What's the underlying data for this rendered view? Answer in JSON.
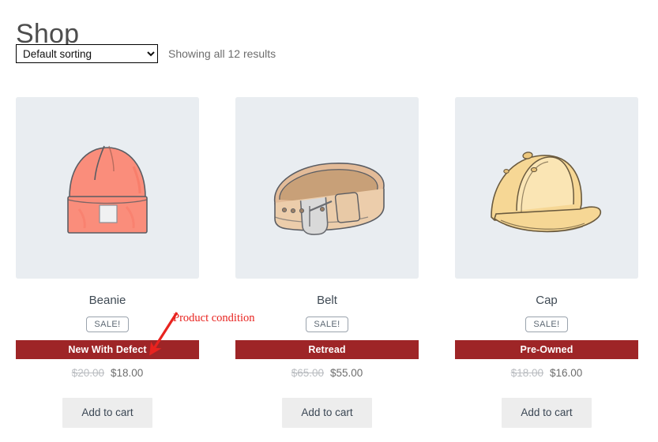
{
  "header": {
    "title": "Shop"
  },
  "toolbar": {
    "sort_selected": "Default sorting",
    "sort_options": [
      "Default sorting"
    ],
    "result_count": "Showing all 12 results"
  },
  "annotation": {
    "label": "Product condition",
    "color": "#e8231f"
  },
  "colors": {
    "condition_banner_bg": "#9e2527",
    "thumb_bg": "#e9edf1",
    "add_to_cart_bg": "#ededed",
    "sale_badge_border": "#9aa3ad"
  },
  "products": [
    {
      "title": "Beanie",
      "badge": "SALE!",
      "condition": "New With Defect",
      "price_old": "$20.00",
      "price_new": "$18.00",
      "add_to_cart_label": "Add to cart",
      "image_name": "beanie-illustration"
    },
    {
      "title": "Belt",
      "badge": "SALE!",
      "condition": "Retread",
      "price_old": "$65.00",
      "price_new": "$55.00",
      "add_to_cart_label": "Add to cart",
      "image_name": "belt-illustration"
    },
    {
      "title": "Cap",
      "badge": "SALE!",
      "condition": "Pre-Owned",
      "price_old": "$18.00",
      "price_new": "$16.00",
      "add_to_cart_label": "Add to cart",
      "image_name": "cap-illustration"
    }
  ]
}
